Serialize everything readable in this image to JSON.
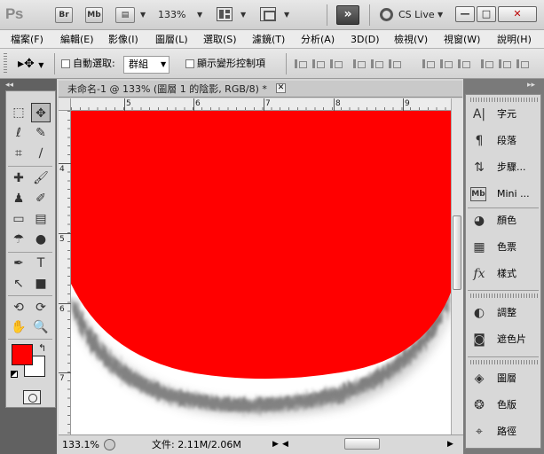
{
  "appbar": {
    "logo": "Ps",
    "bridge": "Br",
    "minibridge": "Mb",
    "zoom": "133%",
    "cslive": "CS Live",
    "ext": "»",
    "win_min": "—",
    "win_max": "□",
    "win_close": "✕"
  },
  "menu": [
    "檔案(F)",
    "編輯(E)",
    "影像(I)",
    "圖層(L)",
    "選取(S)",
    "濾鏡(T)",
    "分析(A)",
    "3D(D)",
    "檢視(V)",
    "視窗(W)",
    "說明(H)"
  ],
  "options": {
    "auto_select_label": "自動選取:",
    "auto_select_value": "群組",
    "show_transform_label": "顯示變形控制項"
  },
  "document": {
    "tab_title": "未命名-1 @ 133% (圖層 1 的陰影, RGB/8) *",
    "close": "✕",
    "ruler_h": [
      "5",
      "6",
      "7",
      "8",
      "9"
    ],
    "ruler_v": [
      "4",
      "5",
      "6",
      "7"
    ]
  },
  "status": {
    "zoom": "133.1%",
    "doc_info": "文件: 2.11M/2.06M"
  },
  "panels": [
    {
      "label": "字元",
      "icon": "character-icon"
    },
    {
      "label": "段落",
      "icon": "paragraph-icon"
    },
    {
      "label": "步驟...",
      "icon": "history-icon"
    },
    {
      "label": "Mini ...",
      "icon": "mini-bridge-icon"
    },
    {
      "label": "顏色",
      "icon": "color-icon"
    },
    {
      "label": "色票",
      "icon": "swatches-icon"
    },
    {
      "label": "樣式",
      "icon": "styles-icon"
    },
    {
      "label": "調整",
      "icon": "adjustments-icon"
    },
    {
      "label": "遮色片",
      "icon": "masks-icon"
    },
    {
      "label": "圖層",
      "icon": "layers-icon"
    },
    {
      "label": "色版",
      "icon": "channels-icon"
    },
    {
      "label": "路徑",
      "icon": "paths-icon"
    }
  ],
  "colors": {
    "foreground": "#ff0000",
    "background": "#ffffff",
    "shape_fill": "#ff0000"
  }
}
